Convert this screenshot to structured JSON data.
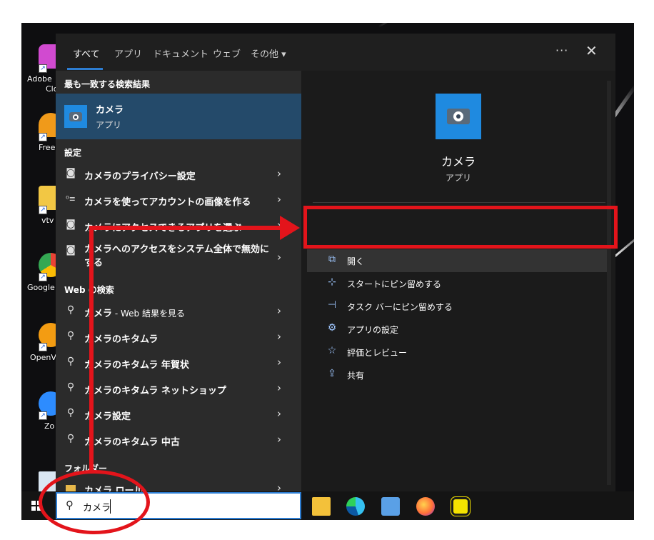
{
  "desktop": {
    "icons": [
      {
        "label": "Adobe",
        "label2": "Clo",
        "color": "#d14ad0"
      },
      {
        "label": "Freel",
        "label2": "",
        "color": "#f09a1a"
      },
      {
        "label": "vtv",
        "label2": "",
        "color": "#f2c744"
      },
      {
        "label": "Google",
        "label2": "",
        "color": "#2ea84f"
      },
      {
        "label": "OpenV",
        "label2": "",
        "color": "#f39c12"
      },
      {
        "label": "Zo",
        "label2": "",
        "color": "#2d8cff"
      },
      {
        "label": "",
        "label2": "",
        "color": "#d9e6f2"
      }
    ],
    "shortcut_glyph": "↗"
  },
  "tabs": {
    "all": "すべて",
    "apps": "アプリ",
    "documents": "ドキュメント",
    "web": "ウェブ",
    "more": "その他 ▾",
    "ellipsis": "···",
    "close": "✕"
  },
  "results": {
    "best_header": "最も一致する検索結果",
    "best_title": "カメラ",
    "best_sub": "アプリ",
    "settings_header": "設定",
    "settings": [
      {
        "label": "カメラのプライバシー設定",
        "icon": "camera-outline-icon"
      },
      {
        "label": "カメラを使ってアカウントの画像を作る",
        "icon": "account-icon"
      },
      {
        "label": "カメラにアクセスできるアプリを選ぶ",
        "icon": "camera-outline-icon"
      },
      {
        "label": "カメラへのアクセスをシステム全体で無効にする",
        "icon": "camera-outline-icon"
      }
    ],
    "web_header": "Web の検索",
    "web": [
      {
        "label": "カメラ",
        "suffix": " - Web 結果を見る"
      },
      {
        "label": "カメラのキタムラ",
        "suffix": ""
      },
      {
        "label": "カメラのキタムラ 年賀状",
        "suffix": ""
      },
      {
        "label": "カメラのキタムラ ネットショップ",
        "suffix": ""
      },
      {
        "label": "カメラ設定",
        "suffix": ""
      },
      {
        "label": "カメラのキタムラ 中古",
        "suffix": ""
      }
    ],
    "folder_header": "フォルダー",
    "folder_item": "カメラ ロール",
    "chevron": "›",
    "search_glyph": "⚲",
    "camera_glyph": "◙",
    "account_glyph": "⁰≡"
  },
  "detail": {
    "title": "カメラ",
    "sub": "アプリ",
    "actions": [
      {
        "label": "開く",
        "glyph": "⧉"
      },
      {
        "label": "スタートにピン留めする",
        "glyph": "⊹"
      },
      {
        "label": "タスク バーにピン留めする",
        "glyph": "⊣"
      },
      {
        "label": "アプリの設定",
        "glyph": "⚙"
      },
      {
        "label": "評価とレビュー",
        "glyph": "☆"
      },
      {
        "label": "共有",
        "glyph": "⇪"
      }
    ]
  },
  "taskbar": {
    "search_value": "カメラ",
    "search_glyph": "⚲",
    "apps": [
      {
        "name": "file-explorer",
        "color": "#f3c13a"
      },
      {
        "name": "edge",
        "color": "#1b9de2"
      },
      {
        "name": "network",
        "color": "#5aa0e6"
      },
      {
        "name": "firefox",
        "color": "#ff7139"
      },
      {
        "name": "todo",
        "color": "#f4e200"
      }
    ]
  },
  "colors": {
    "accent": "#2d7dd2",
    "annotation_red": "#e3141b",
    "best_match_bg": "#244a6a"
  }
}
